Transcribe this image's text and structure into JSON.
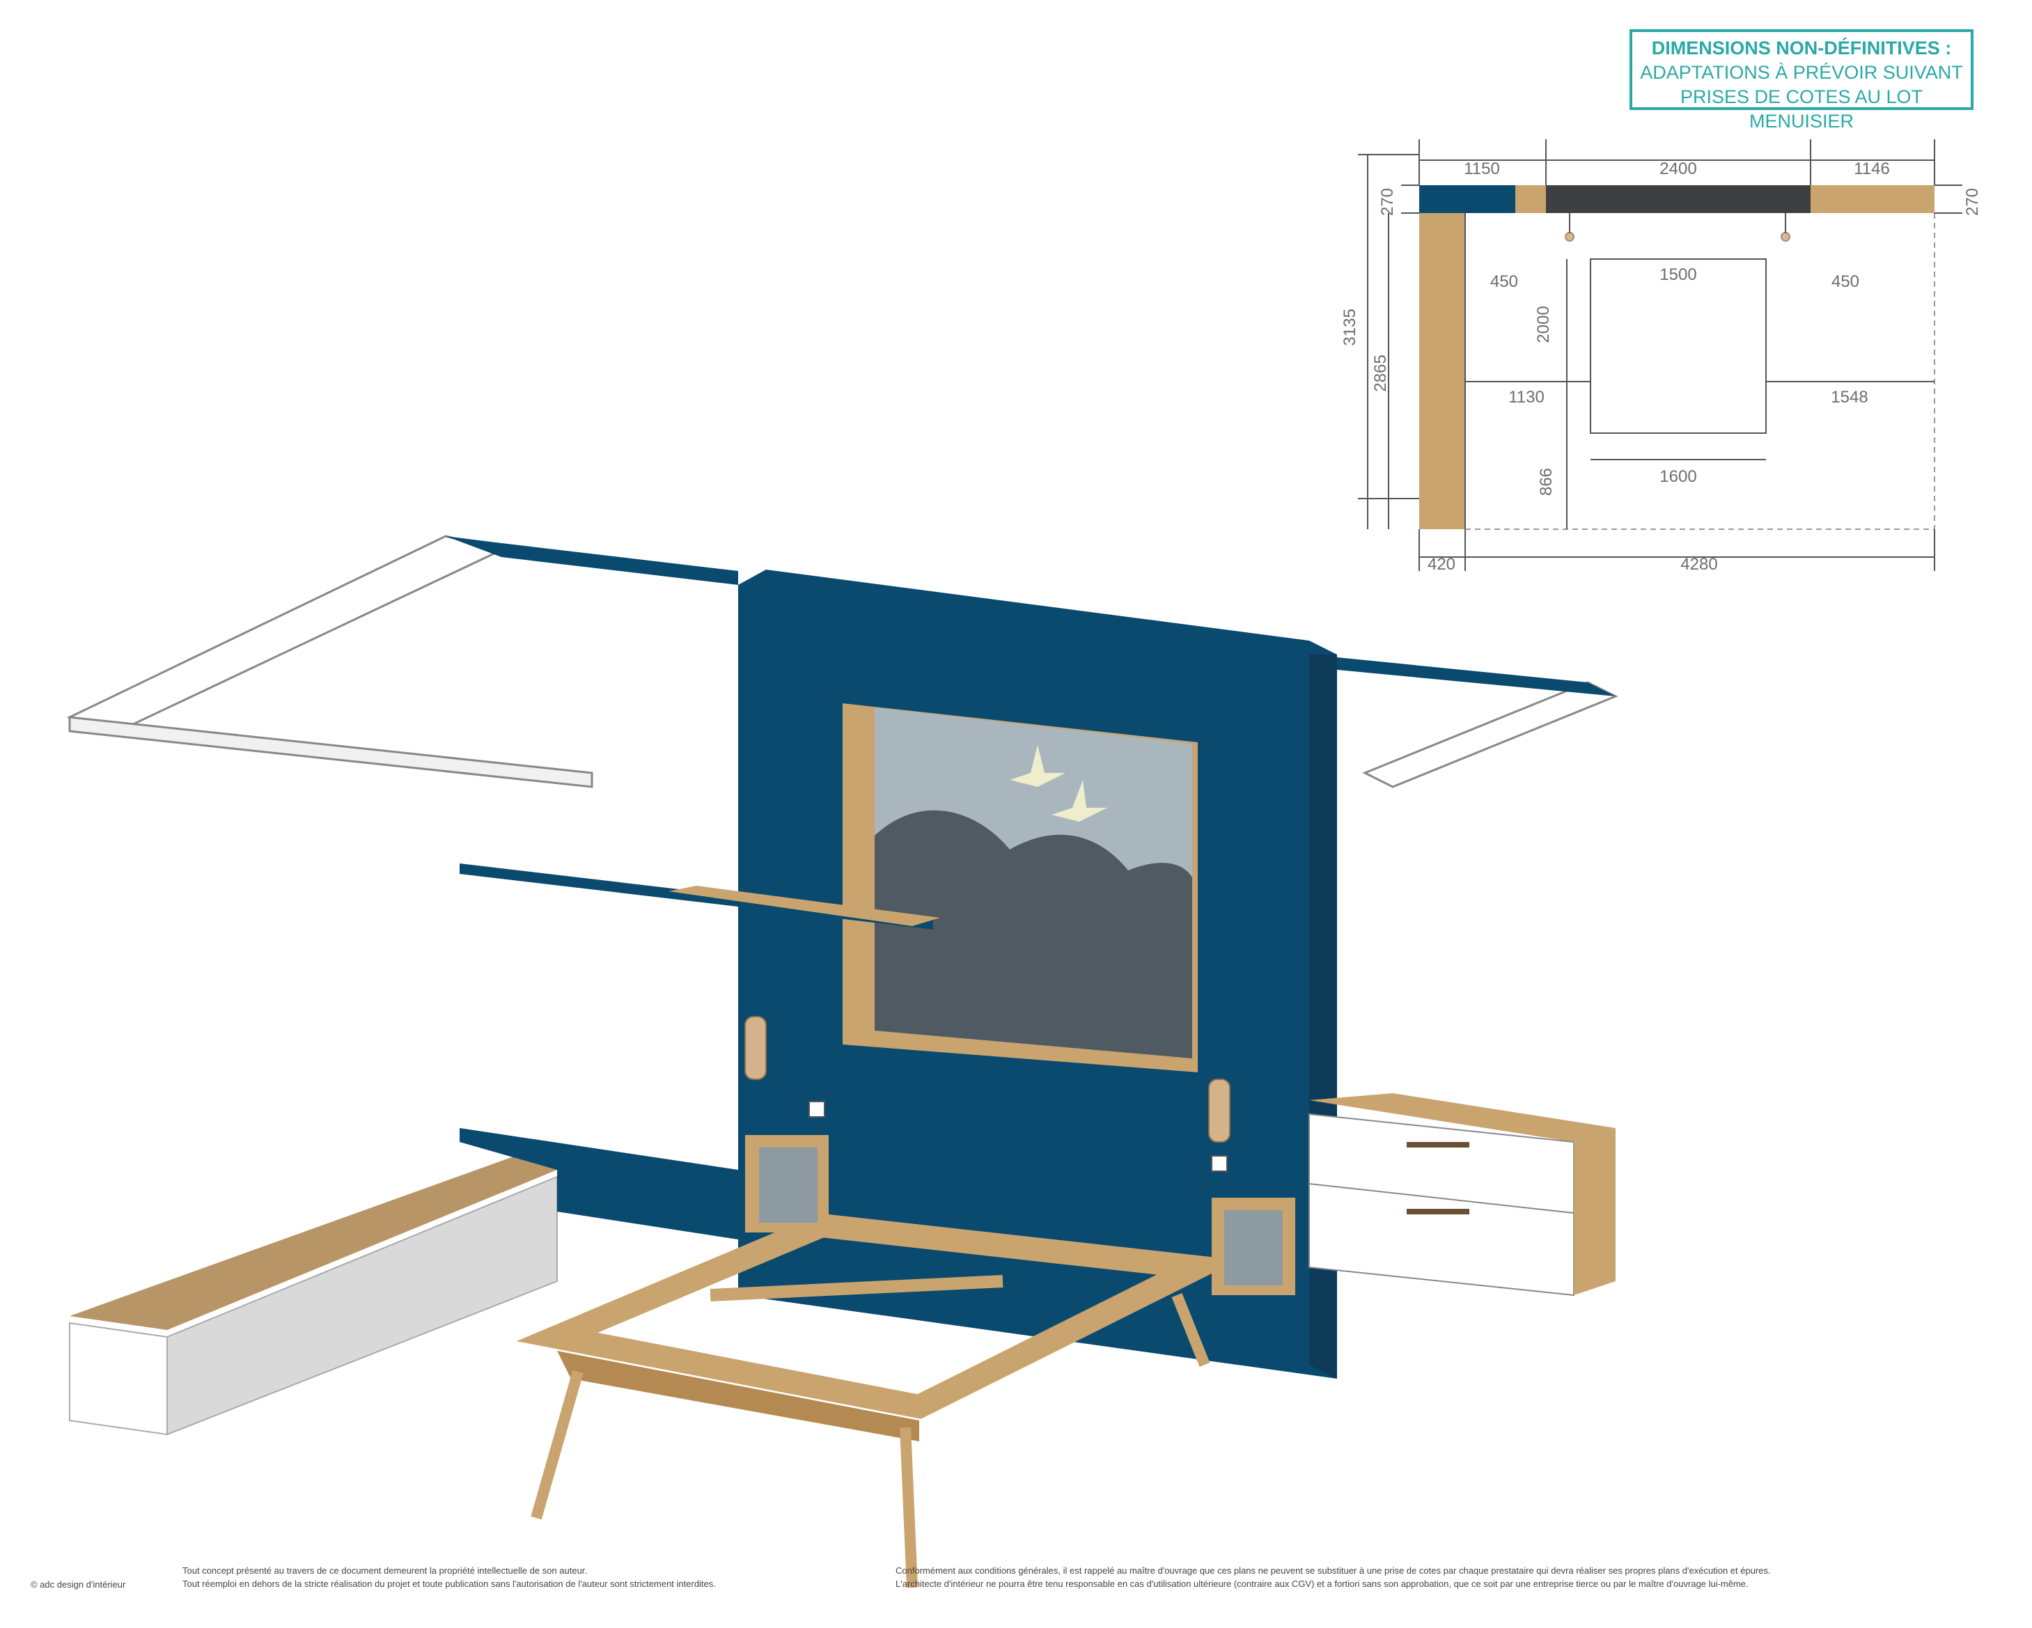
{
  "notice": {
    "line1": "DIMENSIONS NON-DÉFINITIVES :",
    "line2": "ADAPTATIONS À PRÉVOIR SUIVANT",
    "line3": "PRISES DE COTES AU LOT MENUISIER"
  },
  "plan": {
    "top_left": "1150",
    "top_middle": "2400",
    "top_right": "1146",
    "left_thickness": "270",
    "right_thickness": "270",
    "left_total": "3135",
    "left_inner": "2865",
    "lamp_left_offset": "450",
    "lamp_right_offset": "450",
    "bed_inner_width": "1500",
    "bed_length": "2000",
    "side_left": "1130",
    "side_right": "1548",
    "front_gap": "866",
    "bed_outer_width": "1600",
    "bottom_left": "420",
    "bottom_right": "4280"
  },
  "footer": {
    "copyright": "© adc design d'intérieur",
    "ip_line1": "Tout concept présenté au travers de ce document demeurent la propriété intellectuelle de son auteur.",
    "ip_line2": "Tout réemploi en dehors de la stricte réalisation du projet et toute publication sans l'autorisation de l'auteur sont strictement interdites.",
    "legal_line1": "Conformément aux conditions générales, il est rappelé au maître d'ouvrage que ces plans ne peuvent se substituer à une prise de cotes par chaque prestataire qui devra réaliser ses propres plans d'exécution et épures.",
    "legal_line2": "L'architecte d'intérieur ne pourra être tenu responsable en cas d'utilisation ultérieure (contraire aux CGV) et a fortiori sans son approbation, que ce soit par une entreprise tierce ou par le maître d'ouvrage lui-même."
  },
  "colors": {
    "accent_teal": "#2aa9a6",
    "wall_blue": "#0a4a6f",
    "oak": "#c9a46e",
    "charcoal": "#3d3f42"
  }
}
